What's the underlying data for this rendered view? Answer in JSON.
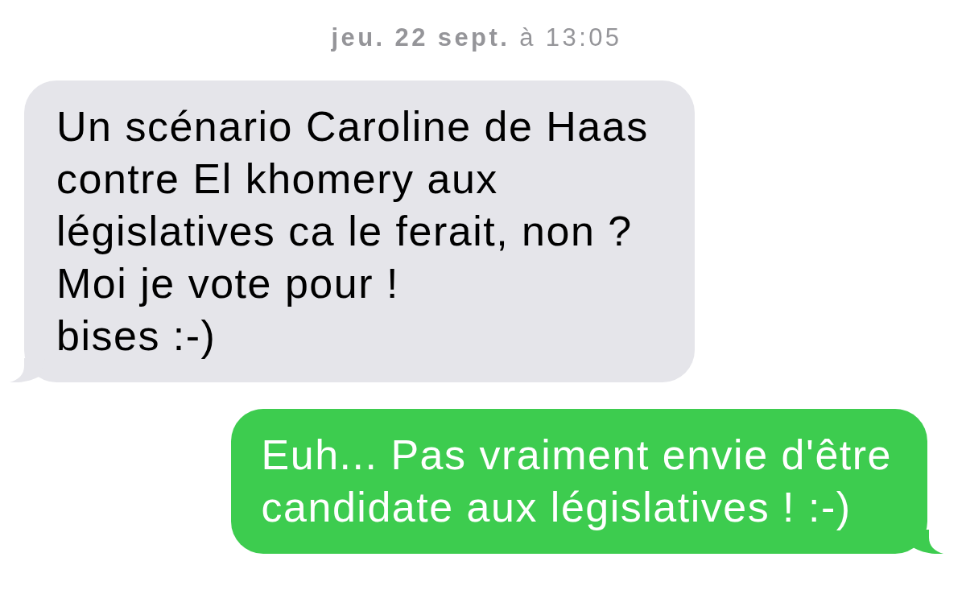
{
  "conversation": {
    "timestamp": "**jeu. 22 sept.** à 13:05",
    "messages": [
      {
        "kind": "received",
        "text": "Un scénario Caroline de Haas\ncontre El khomery aux\nlégislatives ca le ferait, non ?\nMoi je vote pour !\nbises :-)"
      },
      {
        "kind": "sent",
        "text": "Euh... Pas vraiment envie d'être\ncandidate aux législatives ! :-)"
      }
    ]
  }
}
